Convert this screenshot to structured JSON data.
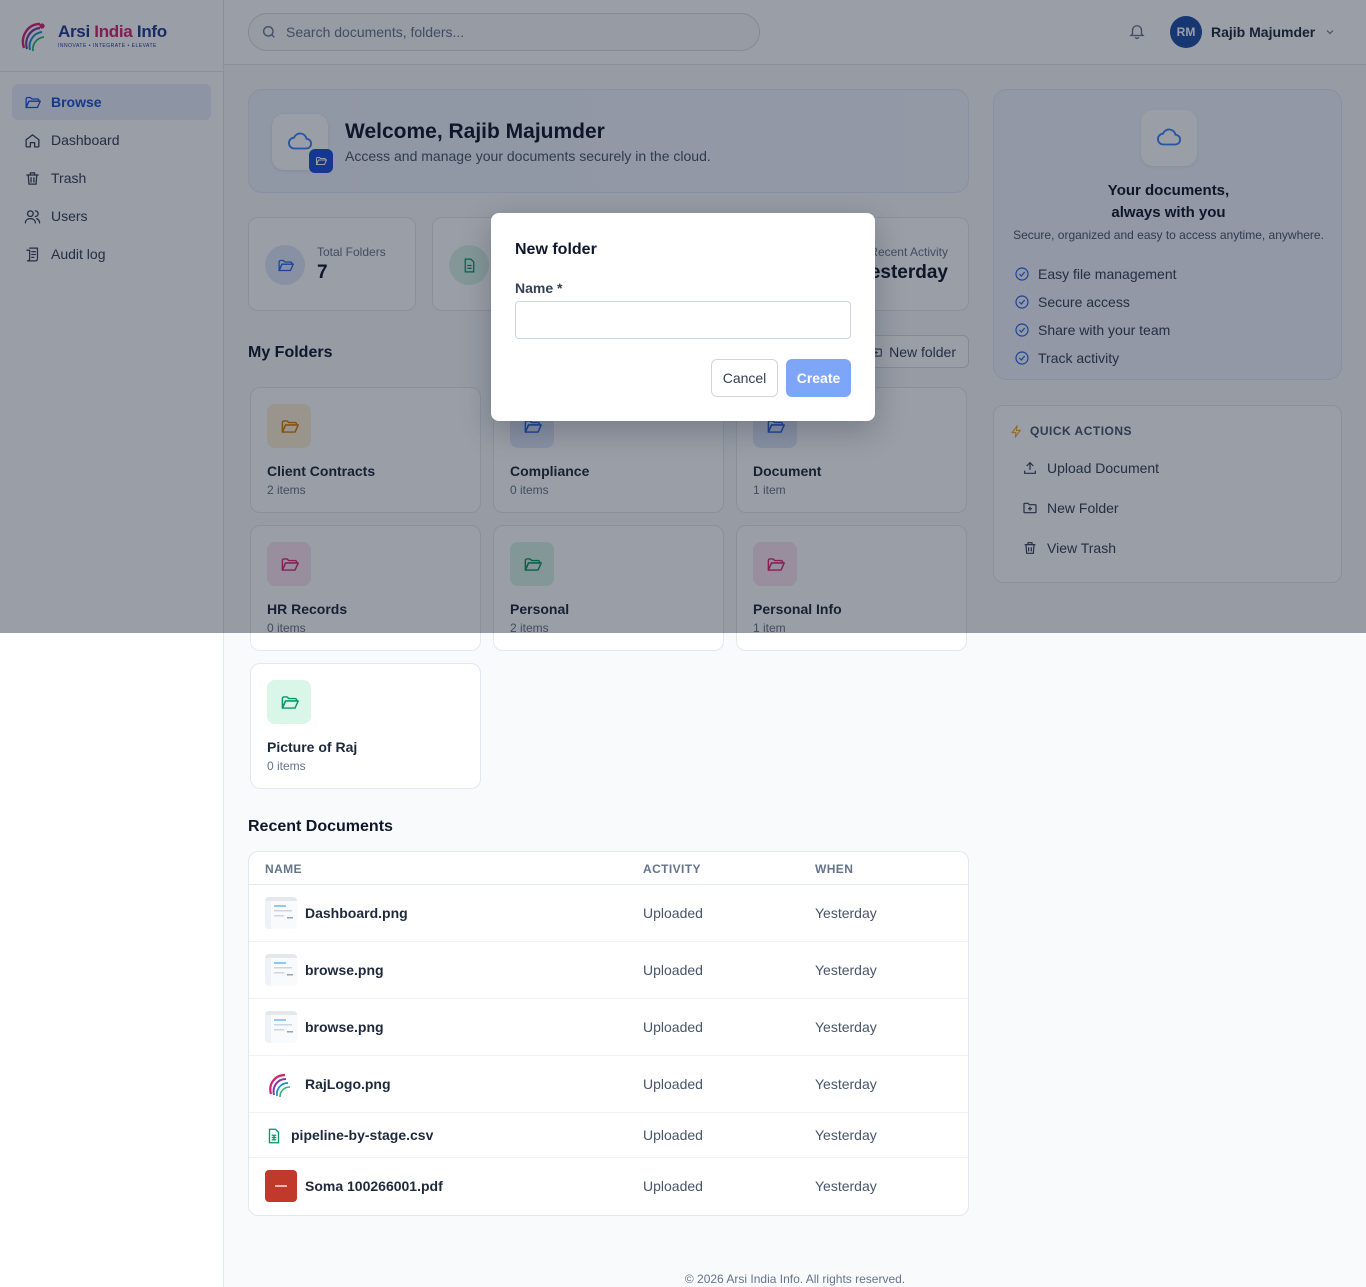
{
  "brand": {
    "name_part1": "Arsi ",
    "name_part2": "India",
    "name_part3": " Info",
    "tagline": "INNOVATE • INTEGRATE • ELEVATE"
  },
  "sidebar": {
    "items": [
      {
        "label": "Browse",
        "icon": "folder-open-icon",
        "active": true
      },
      {
        "label": "Dashboard",
        "icon": "home-icon"
      },
      {
        "label": "Trash",
        "icon": "trash-icon"
      },
      {
        "label": "Users",
        "icon": "users-icon"
      },
      {
        "label": "Audit log",
        "icon": "audit-log-icon"
      }
    ]
  },
  "topbar": {
    "search_placeholder": "Search documents, folders...",
    "user_initials": "RM",
    "user_name": "Rajib Majumder"
  },
  "welcome": {
    "title": "Welcome, Rajib Majumder",
    "subtitle": "Access and manage your documents securely in the cloud."
  },
  "stats": [
    {
      "label": "Total Folders",
      "value": "7"
    },
    {
      "label": "",
      "value": ""
    },
    {
      "label": "Recent Activity",
      "value": "Yesterday"
    }
  ],
  "folders_section": {
    "title": "My Folders",
    "new_folder_label": "New folder",
    "folders": [
      {
        "name": "Client Contracts",
        "count": "2 items",
        "color": "#d97706",
        "bg": "#fdf0d5"
      },
      {
        "name": "Compliance",
        "count": "0 items",
        "color": "#2563eb",
        "bg": "#e0e9fb"
      },
      {
        "name": "Document",
        "count": "1 item",
        "color": "#2563eb",
        "bg": "#e0e9fb"
      },
      {
        "name": "HR Records",
        "count": "0 items",
        "color": "#db2777",
        "bg": "#fce3ef"
      },
      {
        "name": "Personal",
        "count": "2 items",
        "color": "#059669",
        "bg": "#d9f3e6"
      },
      {
        "name": "Personal Info",
        "count": "1 item",
        "color": "#db2777",
        "bg": "#fce3ef"
      },
      {
        "name": "Picture of Raj",
        "count": "0 items",
        "color": "#059669",
        "bg": "#d9f6e8"
      }
    ]
  },
  "recent": {
    "title": "Recent Documents",
    "columns": [
      "NAME",
      "ACTIVITY",
      "WHEN"
    ],
    "rows": [
      {
        "name": "Dashboard.png",
        "activity": "Uploaded",
        "when": "Yesterday",
        "kind": "screenshot"
      },
      {
        "name": "browse.png",
        "activity": "Uploaded",
        "when": "Yesterday",
        "kind": "screenshot"
      },
      {
        "name": "browse.png",
        "activity": "Uploaded",
        "when": "Yesterday",
        "kind": "screenshot"
      },
      {
        "name": "RajLogo.png",
        "activity": "Uploaded",
        "when": "Yesterday",
        "kind": "logo"
      },
      {
        "name": "pipeline-by-stage.csv",
        "activity": "Uploaded",
        "when": "Yesterday",
        "kind": "csv"
      },
      {
        "name": "Soma 100266001.pdf",
        "activity": "Uploaded",
        "when": "Yesterday",
        "kind": "pdf"
      }
    ]
  },
  "promo": {
    "title_line1": "Your documents,",
    "title_line2": "always with you",
    "subtitle": "Secure, organized and easy to access anytime, anywhere.",
    "features": [
      "Easy file management",
      "Secure access",
      "Share with your team",
      "Track activity"
    ]
  },
  "quick_actions": {
    "title": "QUICK ACTIONS",
    "items": [
      "Upload Document",
      "New Folder",
      "View Trash"
    ]
  },
  "modal": {
    "title": "New folder",
    "name_label": "Name *",
    "name_value": "",
    "cancel_label": "Cancel",
    "create_label": "Create"
  },
  "footer": {
    "text": "© 2026 Arsi India Info. All rights reserved."
  }
}
